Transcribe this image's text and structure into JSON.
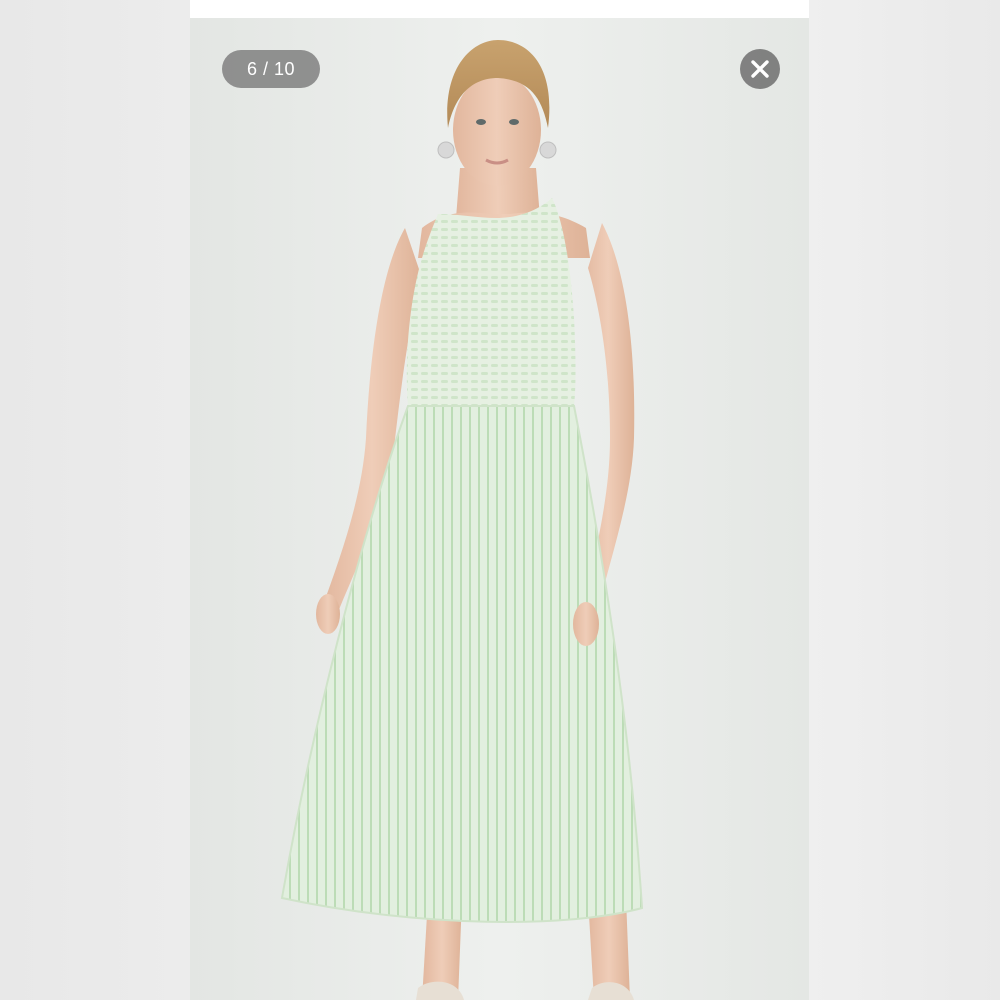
{
  "viewer": {
    "counter": "6 / 10",
    "close_icon": "close-icon",
    "image_subject": "model-in-sleeveless-smocked-midi-dress",
    "colors": {
      "dress": "#dfeedd",
      "stripe": "#b9d9b2",
      "overlay": "#6e6e6e",
      "background": "#e8ebe8"
    }
  }
}
